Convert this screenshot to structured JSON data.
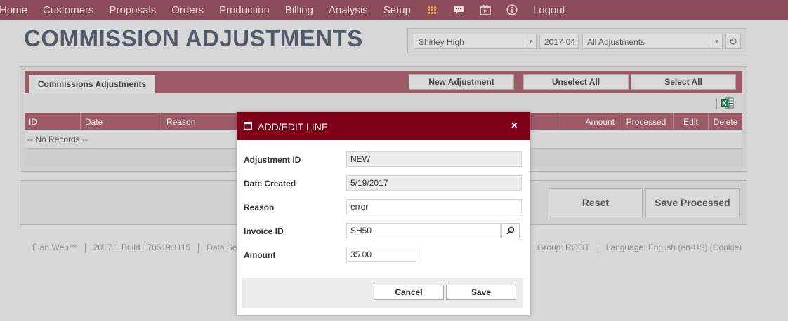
{
  "nav": {
    "items": [
      "Home",
      "Customers",
      "Proposals",
      "Orders",
      "Production",
      "Billing",
      "Analysis",
      "Setup"
    ],
    "icons": [
      "grid-icon",
      "chat-icon",
      "tv-icon",
      "info-icon"
    ],
    "logout": "Logout"
  },
  "page": {
    "title": "COMMISSION ADJUSTMENTS"
  },
  "filters": {
    "user": "Shirley High",
    "period": "2017-04",
    "type": "All Adjustments"
  },
  "grid": {
    "tab_label": "Commissions Adjustments",
    "new_button": "New Adjustment",
    "unselect_button": "Unselect All",
    "select_button": "Select All",
    "columns": [
      "ID",
      "Date",
      "Reason",
      "Amount",
      "Processed",
      "Edit",
      "Delete"
    ],
    "empty_text": "-- No Records --"
  },
  "actions": {
    "reset": "Reset",
    "save_processed": "Save Processed"
  },
  "footer": {
    "left": [
      "Élan.Web™",
      "2017.1 Build 170519.1115",
      "Data Serv"
    ],
    "right": [
      "Group: ROOT",
      "Language: English (en-US) (Cookie)"
    ]
  },
  "modal": {
    "title": "ADD/EDIT LINE",
    "close": "×",
    "fields": {
      "adjustment_id": {
        "label": "Adjustment ID",
        "value": "NEW"
      },
      "date_created": {
        "label": "Date Created",
        "value": "5/19/2017"
      },
      "reason": {
        "label": "Reason",
        "value": "error"
      },
      "invoice_id": {
        "label": "Invoice ID",
        "value": "SH50"
      },
      "amount": {
        "label": "Amount",
        "value": "35.00"
      }
    },
    "cancel": "Cancel",
    "save": "Save"
  },
  "colors": {
    "nav_bg": "#8c4b58",
    "grid_accent": "#9c5a67",
    "modal_header": "#800018",
    "excel_green": "#1e7145"
  }
}
